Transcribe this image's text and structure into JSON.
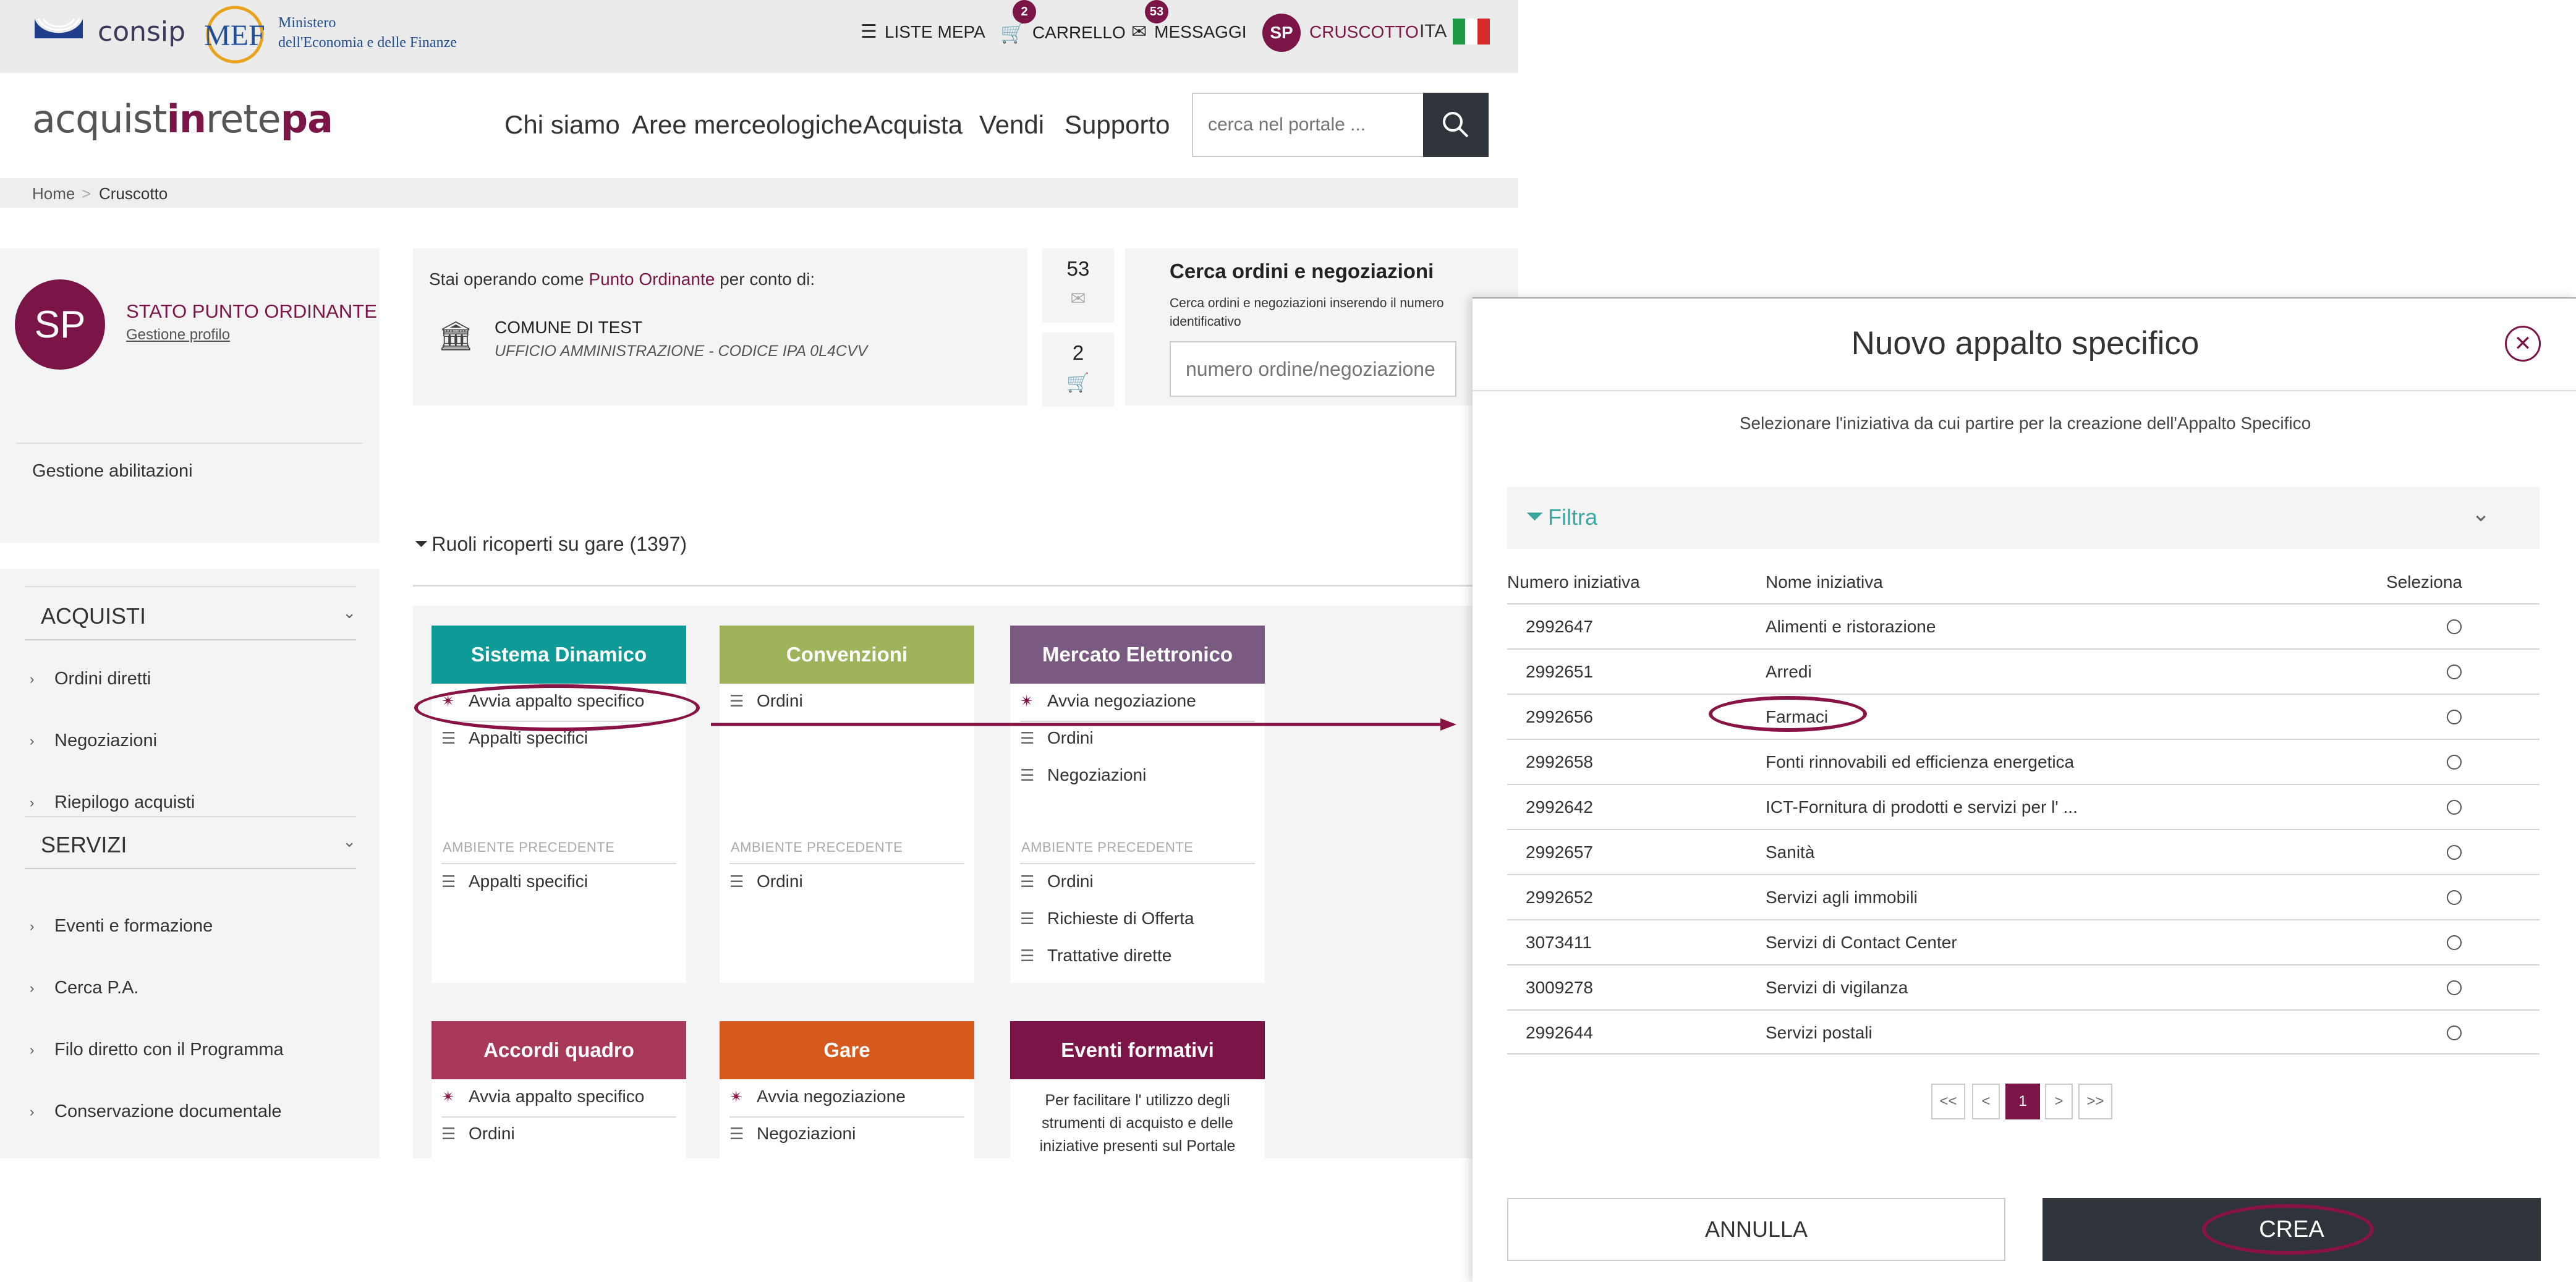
{
  "topbar": {
    "consip_logo": "consip",
    "mef_logo": "MEF",
    "mef_line1": "Ministero",
    "mef_line2": "dell'Economia e delle Finanze",
    "liste_mepa": "LISTE MEPA",
    "carrello": "CARRELLO",
    "carrello_count": "2",
    "messaggi": "MESSAGGI",
    "messaggi_count": "53",
    "user_initials": "SP",
    "cruscotto": "CRUSCOTTO",
    "language": "ITA"
  },
  "brand": {
    "part1": "acquist",
    "part2": "in",
    "part3": "rete",
    "part4": "pa"
  },
  "nav": {
    "items": [
      "Chi siamo",
      "Aree merceologiche",
      "Acquista",
      "Vendi",
      "Supporto"
    ],
    "search_placeholder": "cerca nel portale ..."
  },
  "breadcrumb": {
    "home": "Home",
    "separator": ">",
    "current": "Cruscotto"
  },
  "profile": {
    "initials": "SP",
    "title": "STATO PUNTO ORDINANTE",
    "link": "Gestione profilo",
    "abilitazioni": "Gestione abilitazioni"
  },
  "sidebar": {
    "acquisti_title": "ACQUISTI",
    "acquisti_items": [
      "Ordini diretti",
      "Negoziazioni",
      "Riepilogo acquisti"
    ],
    "servizi_title": "SERVIZI",
    "servizi_items": [
      "Eventi e formazione",
      "Cerca P.A.",
      "Filo diretto con il Programma",
      "Conservazione documentale"
    ]
  },
  "operating": {
    "prefix": "Stai operando come ",
    "role": "Punto Ordinante",
    "suffix": " per conto di:",
    "entity": "COMUNE DI TEST",
    "office": "UFFICIO AMMINISTRAZIONE - CODICE IPA 0L4CVV"
  },
  "counters": {
    "messages": "53",
    "cart": "2"
  },
  "search_orders": {
    "title": "Cerca ordini e negoziazioni",
    "desc": "Cerca ordini e negoziazioni inserendo il numero identificativo",
    "placeholder": "numero ordine/negoziazione"
  },
  "ruoli": {
    "label": "Ruoli ricoperti su gare (1397)"
  },
  "cards": {
    "precedente": "AMBIENTE PRECEDENTE",
    "sd_title": "Sistema Dinamico",
    "sd_items": [
      "Avvia appalto specifico",
      "Appalti specifici"
    ],
    "sd_prev": [
      "Appalti specifici"
    ],
    "conv_title": "Convenzioni",
    "conv_items": [
      "Ordini"
    ],
    "conv_prev": [
      "Ordini"
    ],
    "me_title": "Mercato Elettronico",
    "me_items": [
      "Avvia negoziazione",
      "Ordini",
      "Negoziazioni"
    ],
    "me_prev": [
      "Ordini",
      "Richieste di Offerta",
      "Trattative dirette"
    ],
    "aq_title": "Accordi quadro",
    "aq_items": [
      "Avvia appalto specifico",
      "Ordini"
    ],
    "gare_title": "Gare",
    "gare_items": [
      "Avvia negoziazione",
      "Negoziazioni"
    ],
    "ev_title": "Eventi formativi",
    "ev_text": "Per facilitare l' utilizzo degli strumenti di acquisto e delle iniziative presenti sul Portale"
  },
  "modal": {
    "title": "Nuovo appalto specifico",
    "subtitle": "Selezionare l'iniziativa da cui partire per la creazione dell'Appalto Specifico",
    "filter": "Filtra",
    "columns": [
      "Numero iniziativa",
      "Nome iniziativa",
      "Seleziona"
    ],
    "rows": [
      {
        "num": "2992647",
        "name": "Alimenti e ristorazione"
      },
      {
        "num": "2992651",
        "name": "Arredi"
      },
      {
        "num": "2992656",
        "name": "Farmaci"
      },
      {
        "num": "2992658",
        "name": "Fonti rinnovabili ed efficienza energetica"
      },
      {
        "num": "2992642",
        "name": "ICT-Fornitura di prodotti e servizi per l' ..."
      },
      {
        "num": "2992657",
        "name": "Sanità"
      },
      {
        "num": "2992652",
        "name": "Servizi agli immobili"
      },
      {
        "num": "3073411",
        "name": "Servizi di Contact Center"
      },
      {
        "num": "3009278",
        "name": "Servizi di vigilanza"
      },
      {
        "num": "2992644",
        "name": "Servizi postali"
      }
    ],
    "pagination": [
      "<<",
      "<",
      "1",
      ">",
      ">>"
    ],
    "cancel": "ANNULLA",
    "create": "CREA"
  },
  "colors": {
    "brand": "#7b1447",
    "sistema_dinamico": "#0e9a96",
    "convenzioni": "#9fb35a",
    "mercato_elettronico": "#7a5a80",
    "accordi_quadro": "#a8385a",
    "gare": "#d65a1d",
    "eventi": "#7b1447",
    "dark_button": "#2f343a",
    "filter": "#3aa6a0"
  }
}
